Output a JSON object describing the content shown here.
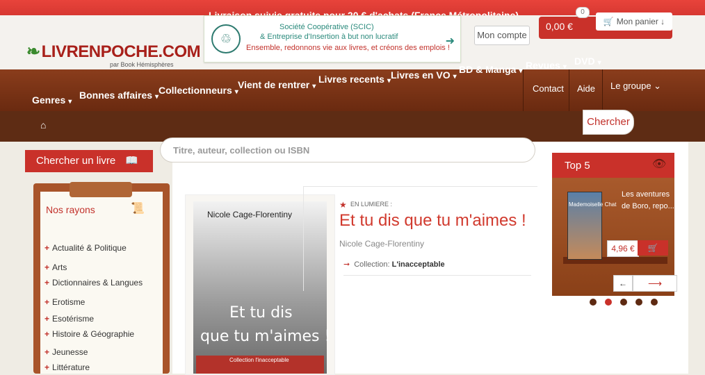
{
  "topbar": {
    "text": "Livraison suivie gratuite pour 20 € d'achats (France Métropolitaine)"
  },
  "logo": {
    "text": "LIVRENPOCHE.COM",
    "subtitle": "par Book Hémisphères"
  },
  "banner": {
    "line1": "Société Coopérative (SCIC)",
    "line2": "& Entreprise d'Insertion à but non lucratif",
    "line3": "Ensemble, redonnons vie aux livres, et créons des emplois !"
  },
  "header": {
    "account_label": "Mon compte",
    "cart_price": "0,00 €",
    "cart_count": "0",
    "cart_label": "Mon panier"
  },
  "nav": {
    "items": [
      "Genres",
      "Bonnes affaires",
      "Collectionneurs",
      "Vient de rentrer",
      "Livres recents",
      "Livres en VO",
      "BD & Manga",
      "Revues",
      "DVD"
    ],
    "sub": [
      "Contact",
      "Aide",
      "Le groupe"
    ]
  },
  "search": {
    "placeholder": "Titre, auteur, collection ou ISBN",
    "button": "Chercher"
  },
  "left": {
    "tab_label": "Chercher un livre",
    "rayons_title": "Nos rayons",
    "rayons": [
      "Actualité & Politique",
      "Arts",
      "Dictionnaires & Langues",
      "Erotisme",
      "Esotérisme",
      "Histoire & Géographie",
      "Jeunesse",
      "Littérature"
    ]
  },
  "featured": {
    "label": "EN LUMIERE :",
    "title": "Et tu dis que tu m'aimes !",
    "author": "Nicole Cage-Florentiny",
    "collection_label": "Collection:",
    "collection": "L'inacceptable",
    "book": {
      "author": "Nicole Cage-Florentiny",
      "title_line1": "Et tu dis",
      "title_line2": "que tu m'aimes !",
      "collection": "Collection l'inacceptable"
    }
  },
  "top5": {
    "title": "Top 5",
    "cover_text": "Mademoiselle Chat",
    "book_line1": "Les aventures",
    "book_line2": "de Boro, repo...",
    "price": "4,96 €",
    "slides": 5,
    "active_slide": 2
  },
  "colors": {
    "accent": "#c9312a",
    "nav_brown": "#7a3416",
    "link_red": "#d13a2e"
  }
}
